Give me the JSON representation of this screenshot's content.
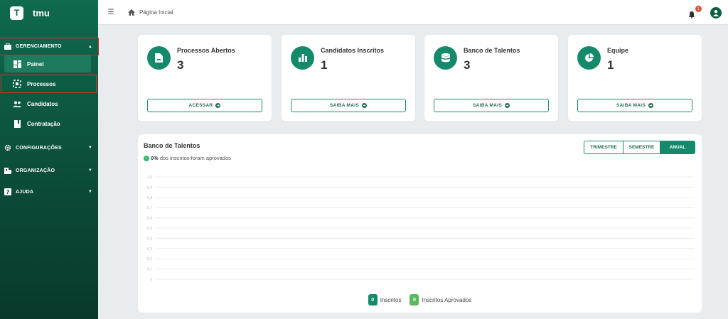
{
  "brand": {
    "logo_letter": "T",
    "name": "tmu"
  },
  "sidebar": {
    "sections": [
      {
        "label": "GERENCIAMENTO",
        "icon": "briefcase-icon",
        "expanded": true
      },
      {
        "label": "CONFIGURAÇÕES",
        "icon": "gear-icon",
        "expanded": false
      },
      {
        "label": "ORGANIZAÇÃO",
        "icon": "building-icon",
        "expanded": false
      },
      {
        "label": "AJUDA",
        "icon": "help-icon",
        "expanded": false
      }
    ],
    "items": [
      {
        "label": "Painel",
        "icon": "dashboard-icon",
        "active": true
      },
      {
        "label": "Processos",
        "icon": "process-icon",
        "active": false
      },
      {
        "label": "Candidatos",
        "icon": "users-icon",
        "active": false
      },
      {
        "label": "Contratação",
        "icon": "contract-icon",
        "active": false
      }
    ]
  },
  "topbar": {
    "breadcrumb": "Página Inicial",
    "notification_count": "1"
  },
  "cards": [
    {
      "title": "Processos Abertos",
      "value": "3",
      "button": "ACESSAR",
      "icon": "document-icon"
    },
    {
      "title": "Candidatos Inscritos",
      "value": "1",
      "button": "SAIBA MAIS",
      "icon": "bar-chart-icon"
    },
    {
      "title": "Banco de Talentos",
      "value": "3",
      "button": "SAIBA MAIS",
      "icon": "database-icon"
    },
    {
      "title": "Equipe",
      "value": "1",
      "button": "SAIBA MAIS",
      "icon": "pie-chart-icon"
    }
  ],
  "panel": {
    "title": "Banco de Talentos",
    "approved_percent": "0%",
    "approved_text": "dos inscritos foram aprovados",
    "period_options": [
      "TRIMESTRE",
      "SEMESTRE",
      "ANUAL"
    ],
    "selected_period": "ANUAL"
  },
  "chart_data": {
    "type": "line",
    "ylim": [
      0,
      1
    ],
    "yticks": [
      "1,0",
      "0,9",
      "0,8",
      "0,7",
      "0,6",
      "0,5",
      "0,4",
      "0,3",
      "0,2",
      "0,1",
      "0"
    ],
    "series": [
      {
        "name": "Inscritos",
        "count_label": "0",
        "color": "#148a6b",
        "values": []
      },
      {
        "name": "Inscritos Aprovados",
        "count_label": "0",
        "color": "#5cb85c",
        "values": []
      }
    ],
    "grid": true
  },
  "colors": {
    "primary": "#148a6b",
    "sidebar": "#0b4a38",
    "badge": "#e74c3c"
  }
}
